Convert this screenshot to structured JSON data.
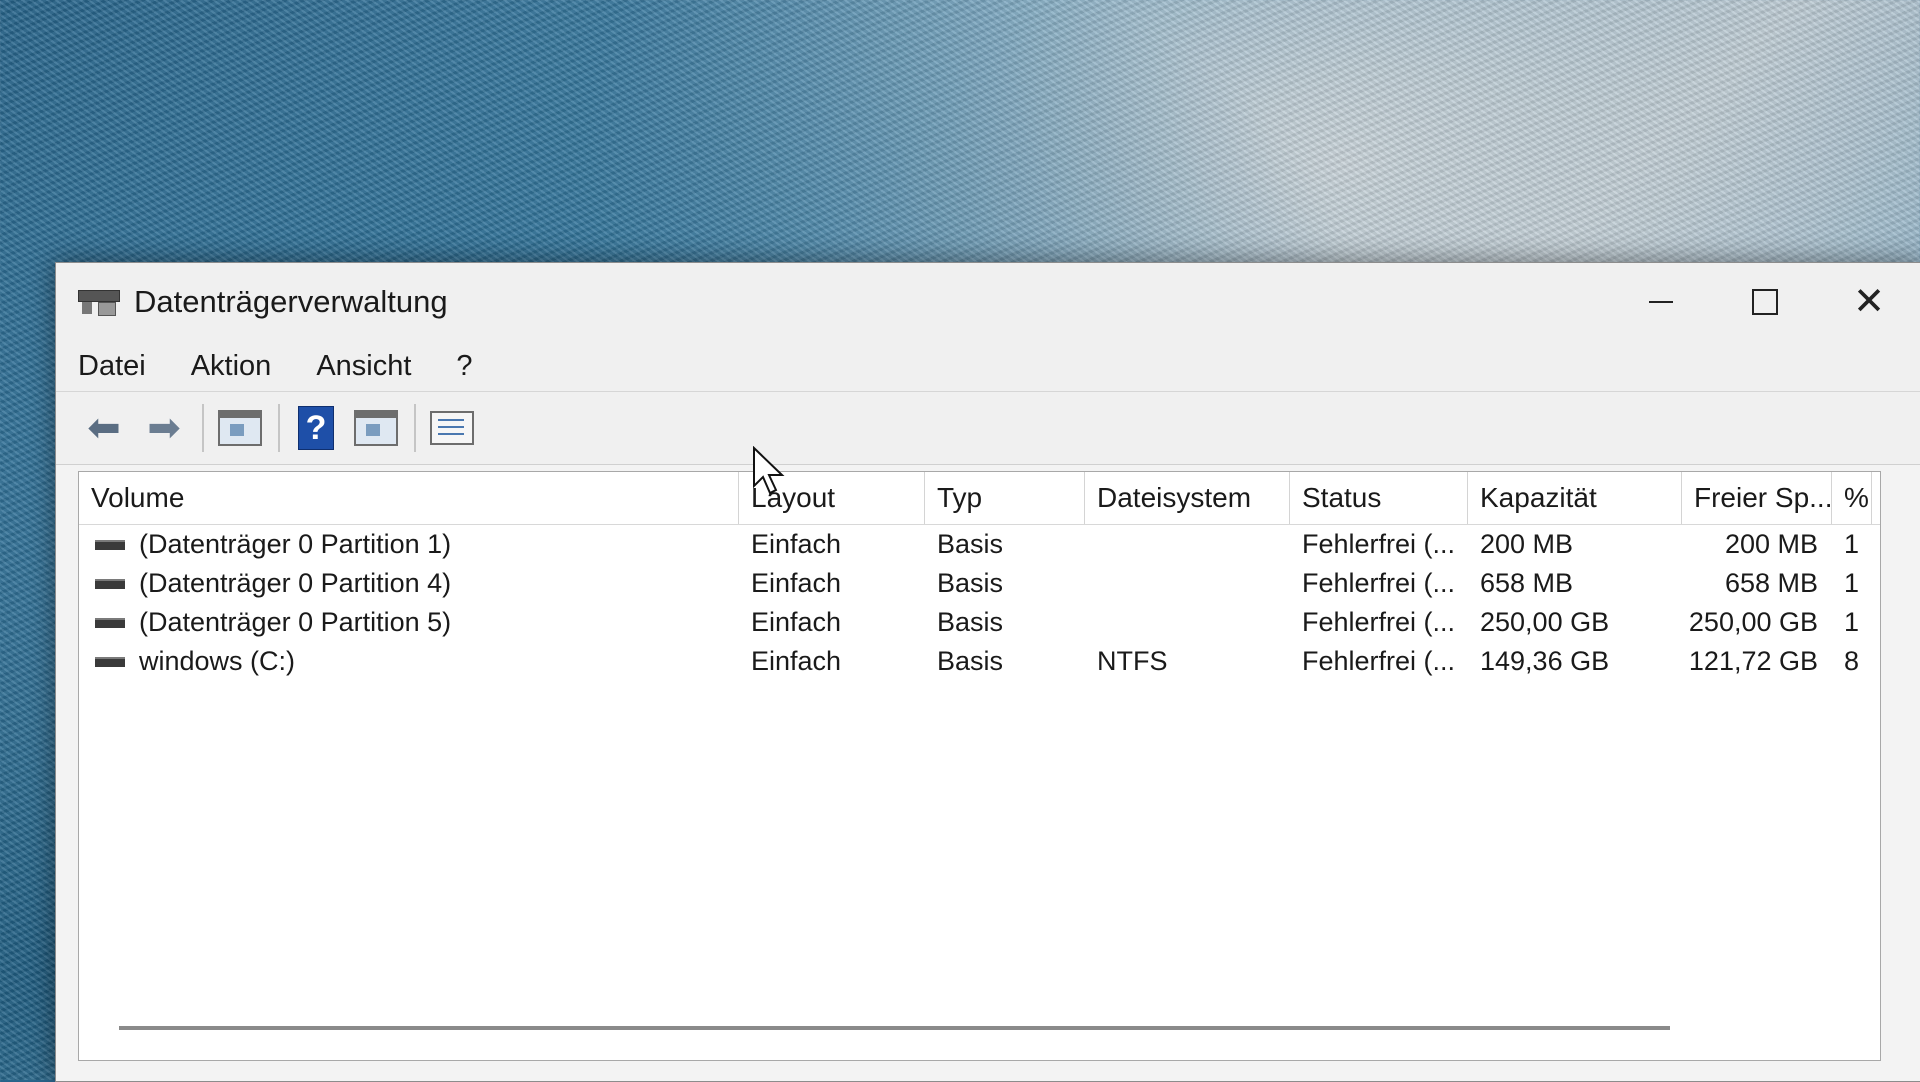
{
  "window": {
    "title": "Datenträgerverwaltung"
  },
  "menu": [
    "Datei",
    "Aktion",
    "Ansicht",
    "?"
  ],
  "toolbar": {
    "icons": [
      "back-arrow-icon",
      "forward-arrow-icon",
      "console-tree-icon",
      "help-icon",
      "action-pane-icon",
      "properties-list-icon"
    ]
  },
  "table": {
    "columns": [
      "Volume",
      "Layout",
      "Typ",
      "Dateisystem",
      "Status",
      "Kapazität",
      "Freier Sp...",
      "%"
    ],
    "rows": [
      [
        "(Datenträger 0 Partition 1)",
        "Einfach",
        "Basis",
        "",
        "Fehlerfrei (...",
        "200 MB",
        "200 MB",
        "1"
      ],
      [
        "(Datenträger 0 Partition 4)",
        "Einfach",
        "Basis",
        "",
        "Fehlerfrei (...",
        "658 MB",
        "658 MB",
        "1"
      ],
      [
        "(Datenträger 0 Partition 5)",
        "Einfach",
        "Basis",
        "",
        "Fehlerfrei (...",
        "250,00 GB",
        "250,00 GB",
        "1"
      ],
      [
        "windows (C:)",
        "Einfach",
        "Basis",
        "NTFS",
        "Fehlerfrei (...",
        "149,36 GB",
        "121,72 GB",
        "8"
      ]
    ]
  },
  "colors": {
    "help_icon": "#1e4fa8",
    "window_bg": "#f3f3f3"
  }
}
